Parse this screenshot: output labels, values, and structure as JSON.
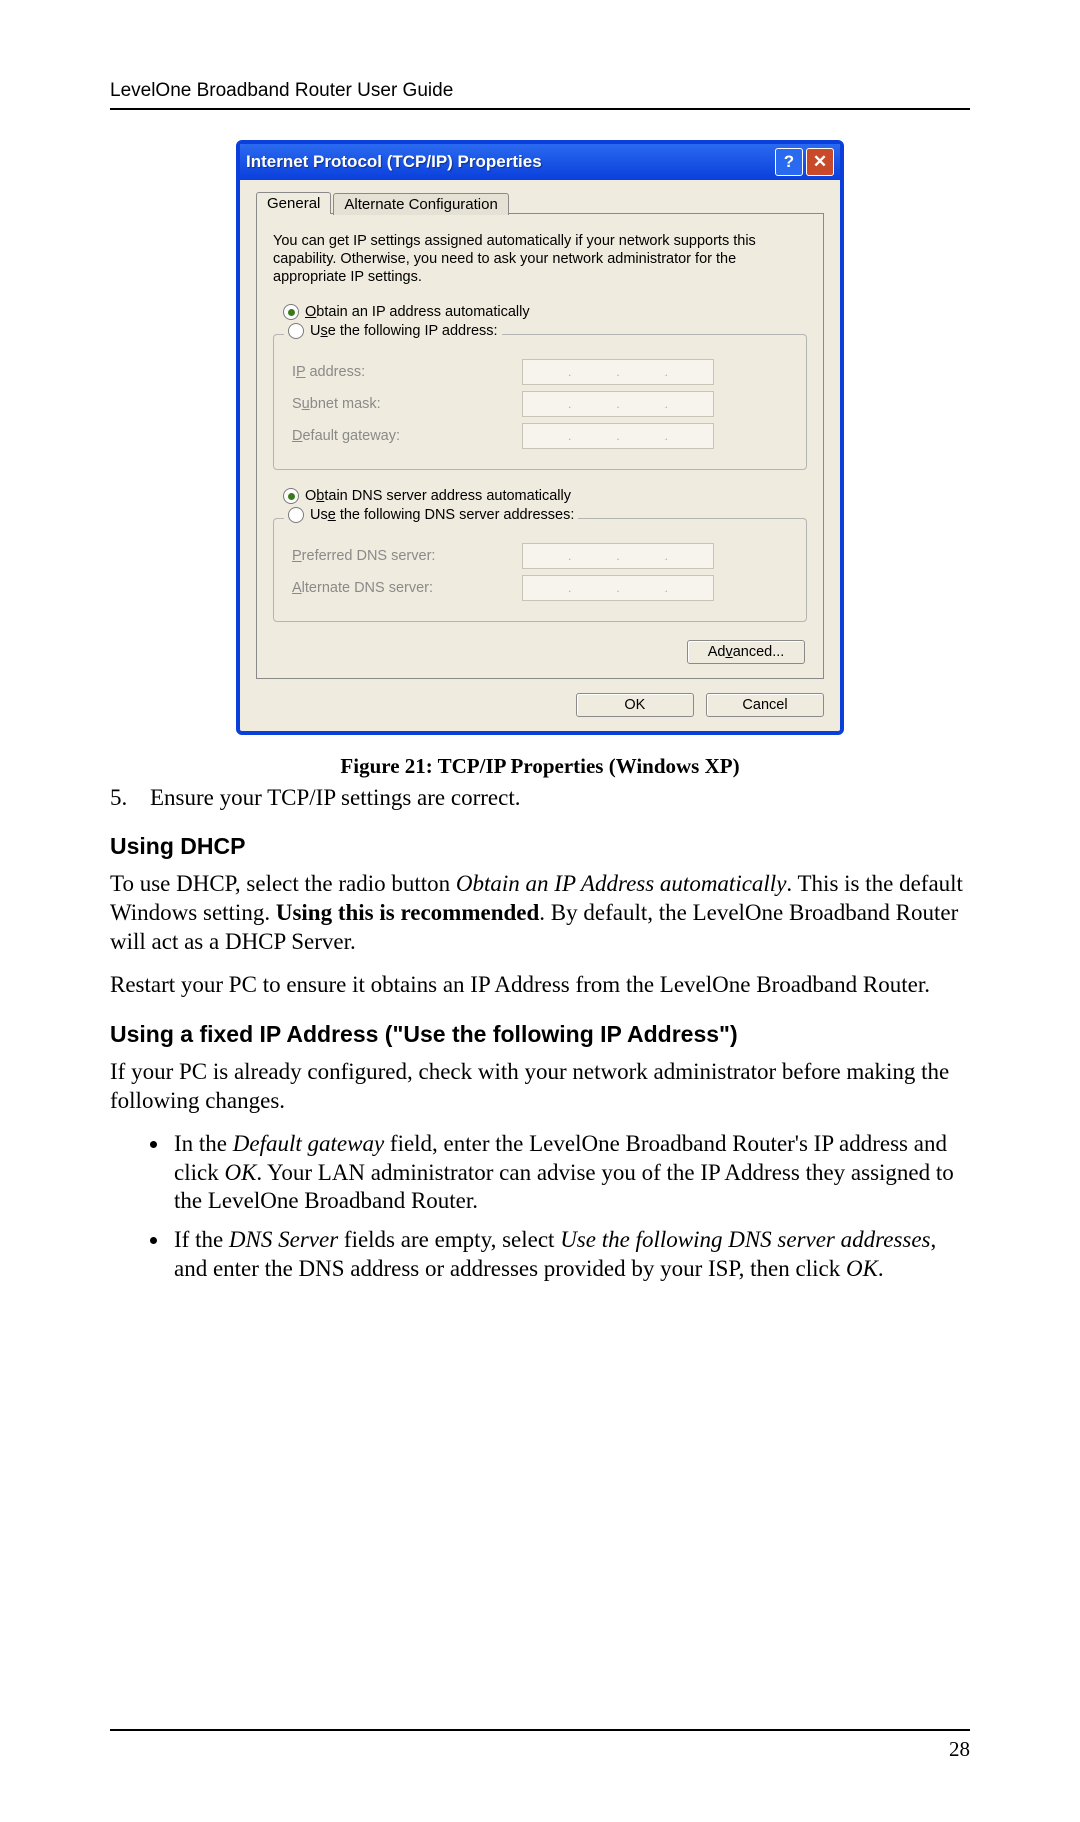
{
  "header": "LevelOne Broadband Router User Guide",
  "dialog": {
    "title": "Internet Protocol (TCP/IP) Properties",
    "help_glyph": "?",
    "close_glyph": "✕",
    "tabs": {
      "general": "General",
      "alt": "Alternate Configuration"
    },
    "desc": "You can get IP settings assigned automatically if your network supports this capability. Otherwise, you need to ask your network administrator for the appropriate IP settings.",
    "ip_auto_pre": "O",
    "ip_auto_post": "btain an IP address automatically",
    "ip_manual_pre": "U",
    "ip_manual_mid": "s",
    "ip_manual_post": "e the following IP address:",
    "lab_ip_pre": "I",
    "lab_ip_u": "P",
    "lab_ip_post": " address:",
    "lab_sub_pre": "S",
    "lab_sub_u": "u",
    "lab_sub_post": "bnet mask:",
    "lab_gw_u": "D",
    "lab_gw_post": "efault gateway:",
    "dns_auto_pre": "O",
    "dns_auto_u": "b",
    "dns_auto_post": "tain DNS server address automatically",
    "dns_manual_pre": "Us",
    "dns_manual_u": "e",
    "dns_manual_post": " the following DNS server addresses:",
    "lab_pdns_u": "P",
    "lab_pdns_post": "referred DNS server:",
    "lab_adns_u": "A",
    "lab_adns_post": "lternate DNS server:",
    "adv_pre": "Ad",
    "adv_u": "v",
    "adv_post": "anced...",
    "ok": "OK",
    "cancel": "Cancel"
  },
  "caption": "Figure 21: TCP/IP Properties (Windows XP)",
  "step": {
    "num": "5.",
    "text": "Ensure your TCP/IP settings are correct."
  },
  "sec1_title": "Using DHCP",
  "sec1_p1a": "To use DHCP, select the radio button ",
  "sec1_p1b": "Obtain an IP Address automatically",
  "sec1_p1c": ". This is the default Windows setting. ",
  "sec1_p1d": "Using this is recommended",
  "sec1_p1e": ". By default, the LevelOne Broadband Router will act as a DHCP Server.",
  "sec1_p2": "Restart your PC to ensure it obtains an IP Address from the LevelOne Broadband Router.",
  "sec2_title": "Using a fixed IP Address (\"Use the following IP Address\")",
  "sec2_p1": "If your PC is already configured, check with your network administrator before making the following changes.",
  "b1a": "In the ",
  "b1b": "Default gateway",
  "b1c": " field, enter the LevelOne Broadband Router's IP address and click ",
  "b1d": "OK",
  "b1e": ". Your LAN administrator can advise you of the IP Address they assigned to the LevelOne Broadband Router.",
  "b2a": "If the ",
  "b2b": "DNS Server",
  "b2c": " fields are empty, select ",
  "b2d": "Use the following DNS server addresses",
  "b2e": ", and enter the DNS address or addresses provided by your ISP, then click ",
  "b2f": "OK",
  "b2g": ".",
  "page_num": "28"
}
